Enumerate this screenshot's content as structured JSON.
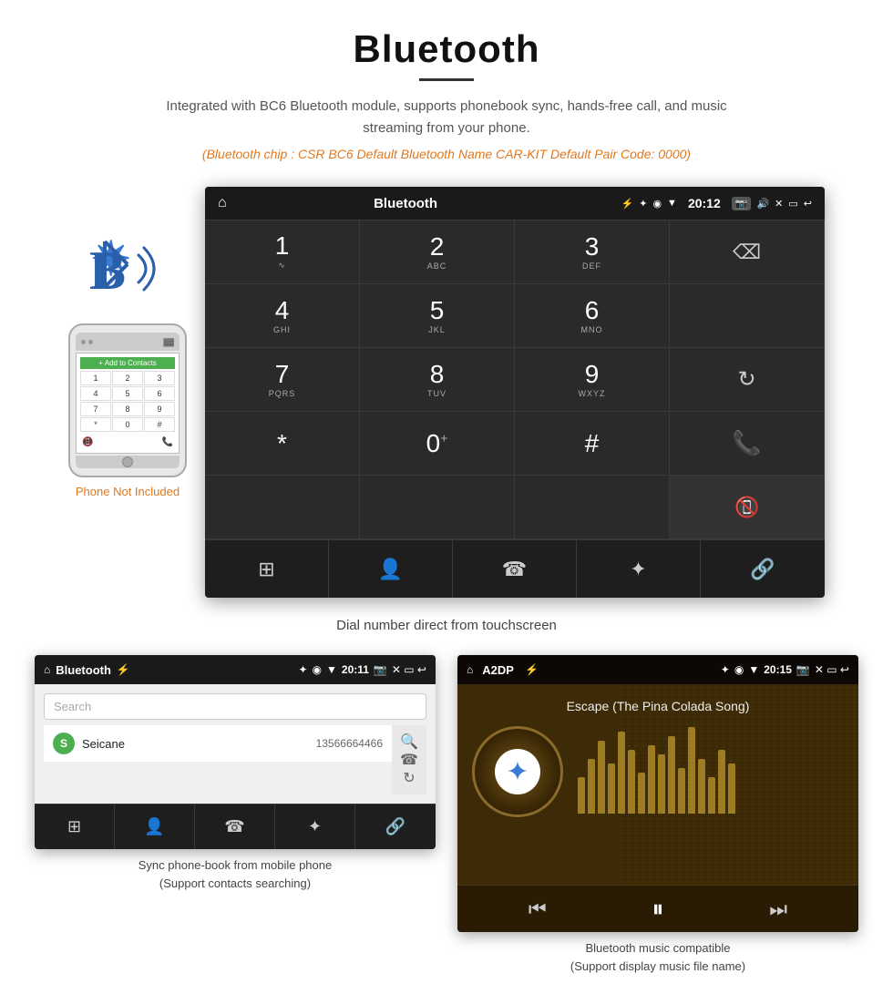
{
  "header": {
    "title": "Bluetooth",
    "subtitle": "Integrated with BC6 Bluetooth module, supports phonebook sync, hands-free call, and music streaming from your phone.",
    "specs": "(Bluetooth chip : CSR BC6    Default Bluetooth Name CAR-KIT    Default Pair Code: 0000)"
  },
  "dial_screen": {
    "status_bar": {
      "home_icon": "⌂",
      "title": "Bluetooth",
      "usb_icon": "⚡",
      "bt_icon": "✦",
      "location_icon": "◉",
      "signal_icon": "▼",
      "time": "20:12",
      "camera_icon": "📷",
      "volume_icon": "🔊",
      "close_icon": "✕",
      "window_icon": "▭",
      "back_icon": "↩"
    },
    "keys": [
      {
        "num": "1",
        "sub": "∿"
      },
      {
        "num": "2",
        "sub": "ABC"
      },
      {
        "num": "3",
        "sub": "DEF"
      },
      {
        "num": "",
        "sub": "",
        "special": "backspace"
      },
      {
        "num": "4",
        "sub": "GHI"
      },
      {
        "num": "5",
        "sub": "JKL"
      },
      {
        "num": "6",
        "sub": "MNO"
      },
      {
        "num": "",
        "sub": "",
        "special": "empty"
      },
      {
        "num": "7",
        "sub": "PQRS"
      },
      {
        "num": "8",
        "sub": "TUV"
      },
      {
        "num": "9",
        "sub": "WXYZ"
      },
      {
        "num": "",
        "sub": "",
        "special": "reload"
      },
      {
        "num": "*",
        "sub": ""
      },
      {
        "num": "0",
        "sub": "+"
      },
      {
        "num": "#",
        "sub": ""
      },
      {
        "num": "",
        "sub": "",
        "special": "call-green"
      },
      {
        "num": "",
        "sub": "",
        "special": "empty"
      },
      {
        "num": "",
        "sub": "",
        "special": "empty"
      },
      {
        "num": "",
        "sub": "",
        "special": "empty"
      },
      {
        "num": "",
        "sub": "",
        "special": "call-red"
      }
    ],
    "bottom_icons": [
      "⊞",
      "👤",
      "☎",
      "✦",
      "🔗"
    ]
  },
  "phonebook_screen": {
    "status_bar": {
      "home_icon": "⌂",
      "title": "Bluetooth",
      "usb_icon": "⚡",
      "bt_icon": "✦",
      "location_icon": "◉",
      "signal_icon": "▼",
      "time": "20:11",
      "camera_icon": "📷"
    },
    "search_placeholder": "Search",
    "contacts": [
      {
        "letter": "S",
        "name": "Seicane",
        "number": "13566664466"
      }
    ],
    "bottom_icons": [
      "⊞",
      "👤",
      "☎",
      "✦",
      "🔗"
    ],
    "side_icons": [
      "🔍",
      "☎",
      "↻"
    ],
    "caption_line1": "Sync phone-book from mobile phone",
    "caption_line2": "(Support contacts searching)"
  },
  "music_screen": {
    "status_bar": {
      "home_icon": "⌂",
      "title": "A2DP",
      "usb_icon": "⚡",
      "bt_icon": "✦",
      "location_icon": "◉",
      "signal_icon": "▼",
      "time": "20:15",
      "camera_icon": "📷"
    },
    "song_title": "Escape (The Pina Colada Song)",
    "eq_bars": [
      40,
      60,
      80,
      55,
      90,
      70,
      45,
      75,
      65,
      85,
      50,
      95,
      60,
      40,
      70,
      55
    ],
    "controls": {
      "prev": "⏮",
      "play_pause": "⏸",
      "next": "⏭"
    },
    "caption_line1": "Bluetooth music compatible",
    "caption_line2": "(Support display music file name)"
  },
  "phone_mock": {
    "add_to_contacts": "+ Add to Contacts",
    "dial_keys": [
      "1",
      "2",
      "3",
      "4",
      "5",
      "6",
      "7",
      "8",
      "9",
      "*",
      "0",
      "#"
    ],
    "not_included": "Phone Not Included"
  },
  "dial_caption": "Dial number direct from touchscreen"
}
